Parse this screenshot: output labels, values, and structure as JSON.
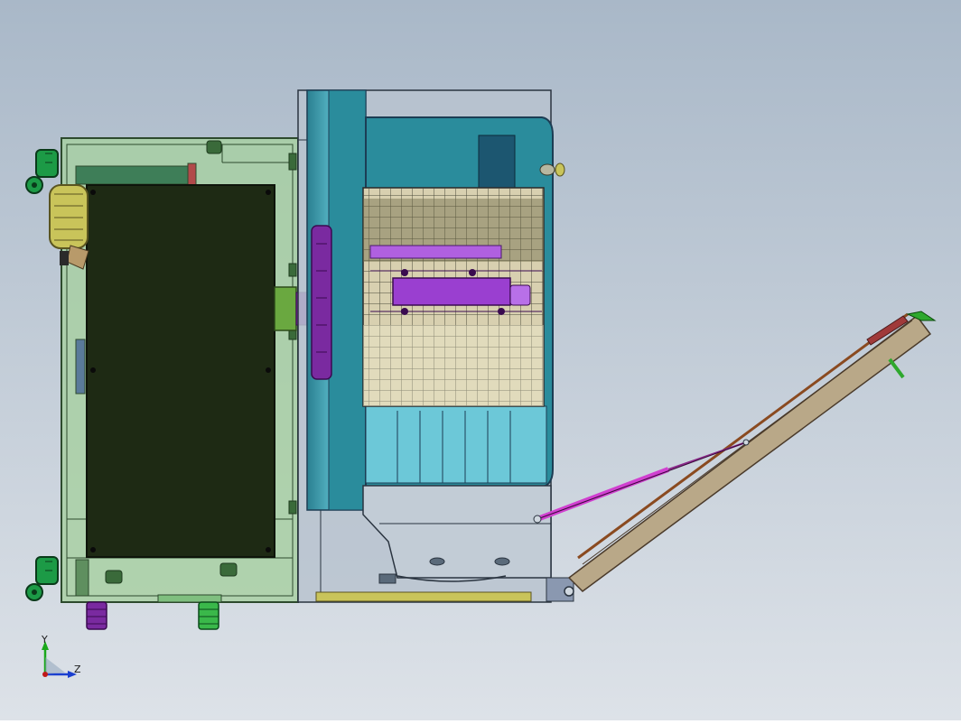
{
  "viewport": {
    "background_top": "#a9b8c8",
    "background_bottom": "#dde2e8"
  },
  "axis_triad": {
    "y_label": "Y",
    "z_label": "Z",
    "y_color": "#1aa81a",
    "z_color": "#1a3fd0",
    "origin_color": "#c01818"
  },
  "colors": {
    "frame_green": "#a6cfa0",
    "frame_line": "#2d4a2d",
    "dark_panel": "#1e2a14",
    "caster_green": "#1c9a46",
    "fan_yellow": "#c9c45a",
    "teal_dark": "#2f7f8f",
    "teal_light": "#6cc8d8",
    "navy": "#1c3d54",
    "purple": "#9a3fd0",
    "magenta": "#d040d0",
    "mesh_fill": "#d8d0b0",
    "panel_brown": "#b9a888",
    "gray_body": "#b9c3cf"
  }
}
